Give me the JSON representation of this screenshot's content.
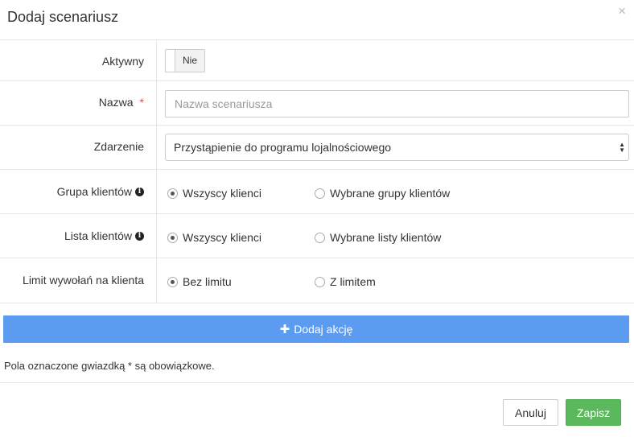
{
  "modal": {
    "title": "Dodaj scenariusz",
    "close_icon": "close-icon",
    "close_glyph": "×"
  },
  "form": {
    "active": {
      "label": "Aktywny",
      "toggle_label": "Nie",
      "value": false
    },
    "name": {
      "label": "Nazwa",
      "required_mark": "*",
      "value": "",
      "placeholder": "Nazwa scenariusza"
    },
    "event": {
      "label": "Zdarzenie",
      "selected": "Przystąpienie do programu lojalnościowego"
    },
    "client_group": {
      "label": "Grupa klientów",
      "info_icon": "info-circle-icon",
      "options": [
        {
          "label": "Wszyscy klienci",
          "checked": true
        },
        {
          "label": "Wybrane grupy klientów",
          "checked": false
        }
      ]
    },
    "client_list": {
      "label": "Lista klientów",
      "info_icon": "info-circle-icon",
      "options": [
        {
          "label": "Wszyscy klienci",
          "checked": true
        },
        {
          "label": "Wybrane listy klientów",
          "checked": false
        }
      ]
    },
    "call_limit": {
      "label": "Limit wywołań na klienta",
      "options": [
        {
          "label": "Bez limitu",
          "checked": true
        },
        {
          "label": "Z limitem",
          "checked": false
        }
      ]
    }
  },
  "add_action": {
    "label": "Dodaj akcję",
    "icon": "plus-icon"
  },
  "note": "Pola oznaczone gwiazdką * są obowiązkowe.",
  "footer": {
    "cancel_label": "Anuluj",
    "save_label": "Zapisz"
  },
  "colors": {
    "primary": "#5b9bf0",
    "success": "#5cb85c",
    "required": "#d9534f"
  }
}
